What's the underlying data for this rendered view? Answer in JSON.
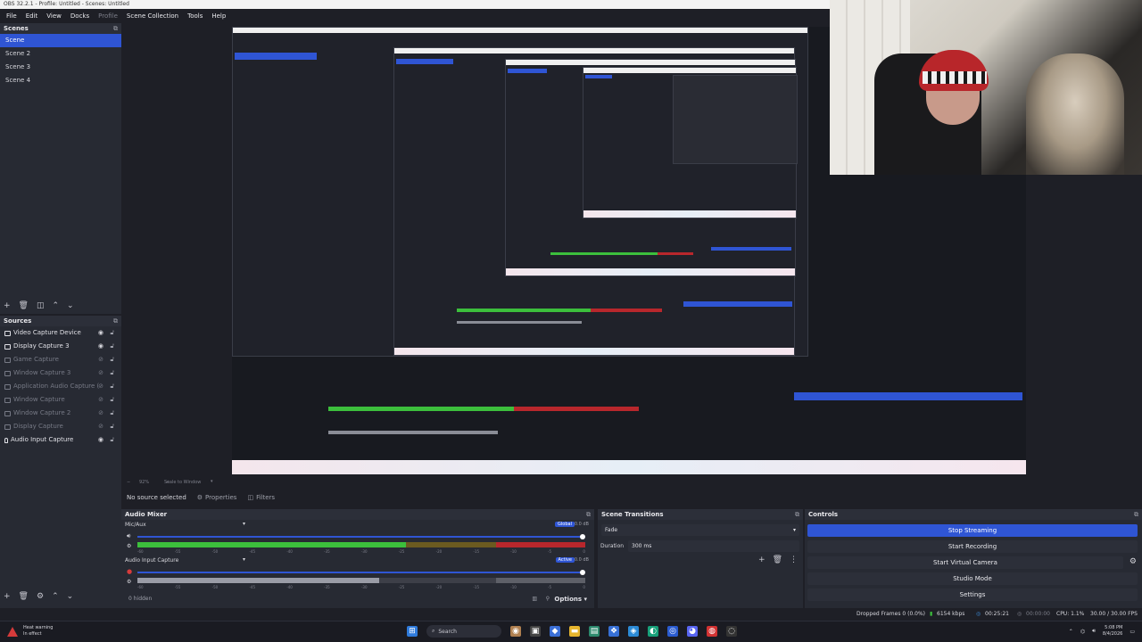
{
  "window": {
    "title": "OBS 32.2.1 - Profile: Untitled - Scenes: Untitled"
  },
  "menu": [
    "File",
    "Edit",
    "View",
    "Docks",
    "Profile",
    "Scene Collection",
    "Tools",
    "Help"
  ],
  "scenes": {
    "title": "Scenes",
    "items": [
      "Scene",
      "Scene 2",
      "Scene 3",
      "Scene 4"
    ],
    "selected": "Scene"
  },
  "sources": {
    "title": "Sources",
    "items": [
      {
        "label": "Video Capture Device",
        "icon": "camera-icon",
        "visible": true
      },
      {
        "label": "Display Capture 3",
        "icon": "monitor-icon",
        "visible": true
      },
      {
        "label": "Game Capture",
        "icon": "gamepad-icon",
        "visible": false
      },
      {
        "label": "Window Capture 3",
        "icon": "window-icon",
        "visible": false
      },
      {
        "label": "Application Audio Capture (BE",
        "icon": "app-audio-icon",
        "visible": false
      },
      {
        "label": "Window Capture",
        "icon": "window-icon",
        "visible": false
      },
      {
        "label": "Window Capture 2",
        "icon": "window-icon",
        "visible": false
      },
      {
        "label": "Display Capture",
        "icon": "monitor-icon",
        "visible": false
      },
      {
        "label": "Audio Input Capture",
        "icon": "mic-icon",
        "visible": true
      }
    ]
  },
  "preview": {
    "zoom": "92%",
    "scale_mode": "Scale to Window"
  },
  "context_bar": {
    "no_source": "No source selected",
    "properties": "Properties",
    "filters": "Filters"
  },
  "mixer": {
    "title": "Audio Mixer",
    "channels": [
      {
        "name": "Mic/Aux",
        "tag": "Global",
        "db": "0.0 dB",
        "level": 0.6
      },
      {
        "name": "Audio Input Capture",
        "tag": "Active",
        "db": "0.0 dB",
        "level": 0.54
      }
    ],
    "scale": [
      "-60",
      "-55",
      "-50",
      "-45",
      "-40",
      "-35",
      "-30",
      "-25",
      "-20",
      "-15",
      "-10",
      "-5",
      "0"
    ],
    "hidden": "0 hidden",
    "options": "Options"
  },
  "transitions": {
    "title": "Scene Transitions",
    "selected": "Fade",
    "duration_label": "Duration",
    "duration_value": "300 ms"
  },
  "controls": {
    "title": "Controls",
    "buttons": [
      "Stop Streaming",
      "Start Recording",
      "Start Virtual Camera",
      "Studio Mode",
      "Settings"
    ]
  },
  "status": {
    "dropped": "Dropped Frames 0 (0.0%)",
    "bitrate": "6154 kbps",
    "stream_time": "00:25:21",
    "rec_time": "00:00:00",
    "cpu": "CPU: 1.1%",
    "fps": "30.00 / 30.00 FPS"
  },
  "taskbar": {
    "warning_title": "Heat warning",
    "warning_sub": "In effect",
    "search": "Search",
    "time": "5:08 PM",
    "date": "8/4/2026"
  },
  "colors": {
    "accent": "#2f55d4",
    "meter_green": "#3cbf3c",
    "meter_red": "#b8272c",
    "panel": "#272a33",
    "bg": "#1e1f26"
  }
}
